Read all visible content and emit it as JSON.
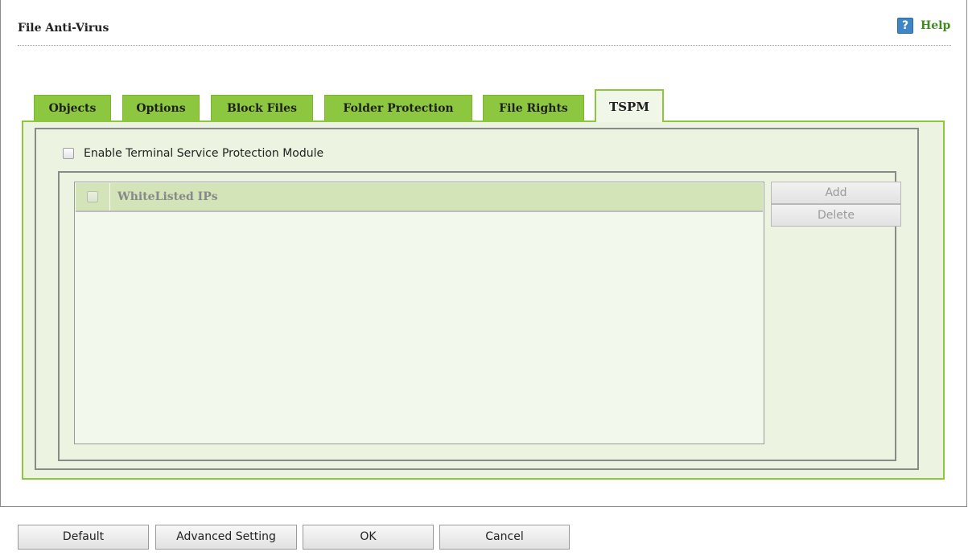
{
  "header": {
    "title": "File Anti-Virus",
    "help_label": "Help",
    "help_icon": "help-question-icon"
  },
  "tabs": [
    {
      "label": "Objects",
      "active": false
    },
    {
      "label": "Options",
      "active": false
    },
    {
      "label": "Block Files",
      "active": false
    },
    {
      "label": "Folder Protection",
      "active": false
    },
    {
      "label": "File Rights",
      "active": false
    },
    {
      "label": "TSPM",
      "active": true
    }
  ],
  "tspm": {
    "enable_label": "Enable Terminal Service Protection Module",
    "enabled": false,
    "list_header": "WhiteListed IPs",
    "add_label": "Add",
    "delete_label": "Delete"
  },
  "footer": {
    "default_label": "Default",
    "advanced_label": "Advanced Setting",
    "ok_label": "OK",
    "cancel_label": "Cancel"
  },
  "colors": {
    "accent_green": "#8dc63f",
    "panel_bg": "#ecf4e1",
    "help_green": "#3e8a1e"
  }
}
